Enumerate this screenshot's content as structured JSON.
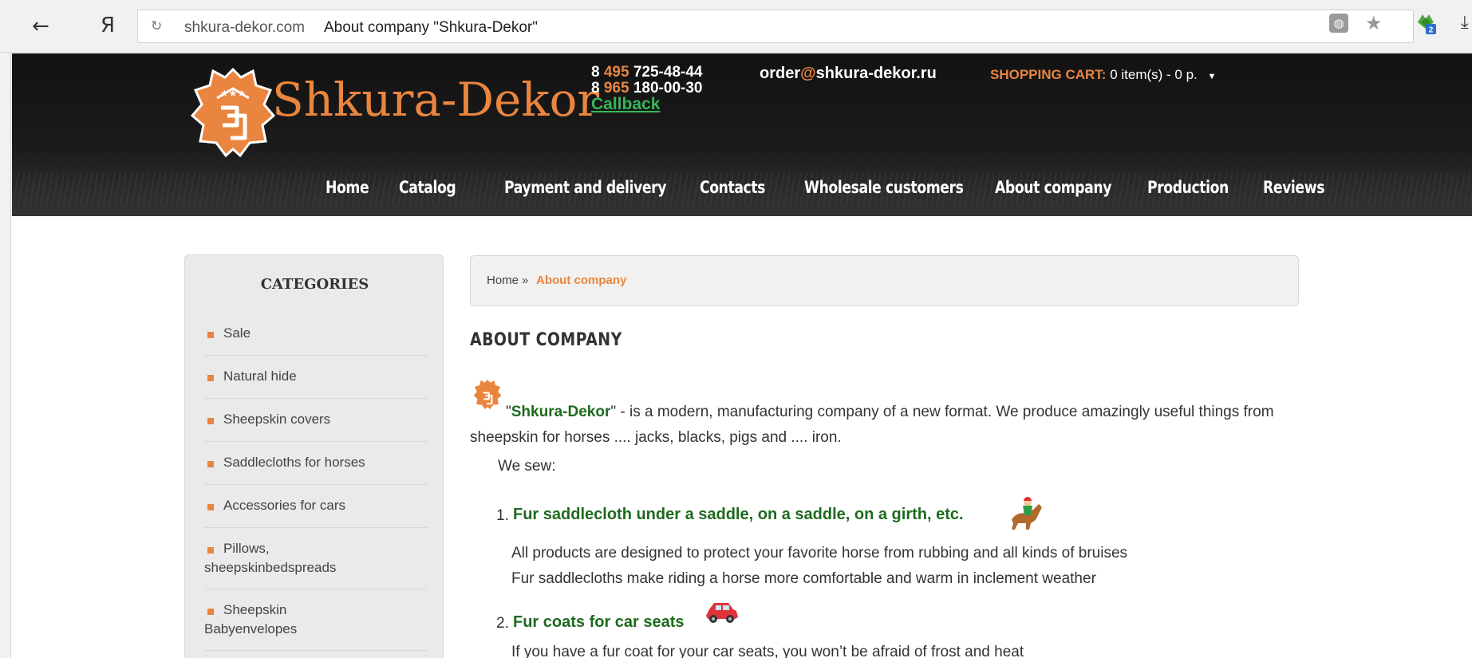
{
  "browser": {
    "back_glyph": "←",
    "yandex_glyph": "Я",
    "reload_glyph": "↻",
    "url_domain": "shkura-dekor.com",
    "url_title": "About company \"Shkura-Dekor\"",
    "ext_globe_glyph": "◍",
    "star_glyph": "★",
    "download_glyph": "⤓",
    "frog_badge": "2"
  },
  "header": {
    "logo_text": "Shkura-Dekor",
    "phone1_prefix": "8",
    "phone1_code": "495",
    "phone1_number": "725-48-44",
    "phone2_prefix": "8",
    "phone2_code": "965",
    "phone2_number": "180-00-30",
    "callback": "Callback",
    "email_user": "order",
    "email_at": "@",
    "email_domain": "shkura-dekor.ru",
    "cart_label": "SHOPPING CART:",
    "cart_value": "0 item(s) - 0 р.",
    "cart_caret": "▼"
  },
  "nav": [
    {
      "label": "Home"
    },
    {
      "label": "Catalog"
    },
    {
      "label": "Payment and delivery"
    },
    {
      "label": "Contacts"
    },
    {
      "label": "Wholesale customers"
    },
    {
      "label": "About company"
    },
    {
      "label": "Production"
    },
    {
      "label": "Reviews"
    }
  ],
  "sidebar": {
    "title": "CATEGORIES",
    "items": [
      {
        "label": "Sale"
      },
      {
        "label": "Natural hide"
      },
      {
        "label": "Sheepskin covers"
      },
      {
        "label": "Saddlecloths for horses"
      },
      {
        "label": "Accessories for cars"
      },
      {
        "label": "Pillows, sheepskinbedspreads"
      },
      {
        "label": "Sheepskin Babyenvelopes"
      }
    ]
  },
  "breadcrumb": {
    "home": "Home",
    "separator": "»",
    "current": "About company"
  },
  "page": {
    "title": "ABOUT COMPANY",
    "intro_open_quote": "\"",
    "intro_brand": "Shkura-Dekor",
    "intro_rest": "\" - is a modern, manufacturing company of a new format. We produce amazingly useful things from sheepskin for horses .... jacks, blacks, pigs and .... iron.",
    "we_sew": "We sew:",
    "list": [
      {
        "num": "1.",
        "heading": "Fur saddlecloth under a saddle, on a saddle, on a girth, etc.",
        "lines": [
          "All products are designed to protect your favorite horse from rubbing and all kinds of bruises",
          "Fur saddlecloths make riding a horse more comfortable and warm in inclement weather"
        ]
      },
      {
        "num": "2.",
        "heading": "Fur coats for car seats",
        "lines": [
          "If you have a fur coat for your car seats, you won’t be afraid of frost and heat"
        ]
      }
    ]
  }
}
